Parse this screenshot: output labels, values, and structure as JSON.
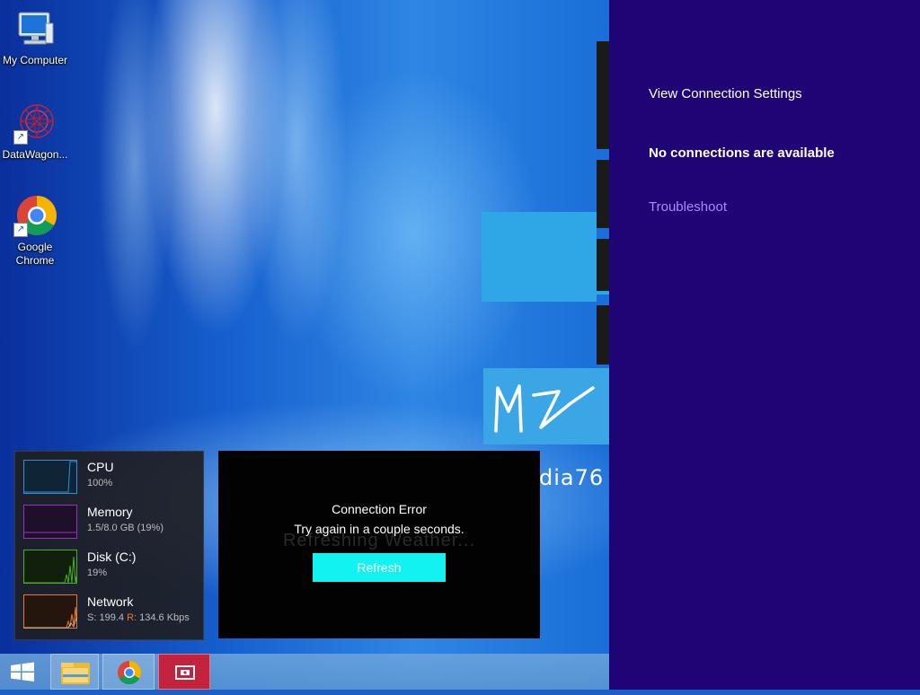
{
  "desktop": {
    "icons": [
      {
        "label": "My Computer",
        "icon": "computer-icon"
      },
      {
        "label": "DataWagon...",
        "icon": "datawagon-icon"
      },
      {
        "label": "Google Chrome",
        "icon": "chrome-icon"
      }
    ]
  },
  "background_app": {
    "partial_text": "dia76"
  },
  "resource_monitor": {
    "cpu": {
      "title": "CPU",
      "value": "100%",
      "color": "#2f8fd8"
    },
    "memory": {
      "title": "Memory",
      "value": "1.5/8.0 GB (19%)",
      "color": "#9b2fc4"
    },
    "disk": {
      "title": "Disk (C:)",
      "value": "19%",
      "color": "#4caf20"
    },
    "network": {
      "title": "Network",
      "sent_label": "S:",
      "sent_value": "199.4",
      "recv_label": "R:",
      "recv_value": "134.6 Kbps",
      "color": "#e07a30"
    }
  },
  "error_panel": {
    "title": "Connection Error",
    "message": "Try again in a couple seconds.",
    "ghost_text": "Refreshing Weather...",
    "refresh_label": "Refresh",
    "button_color": "#12f2f0"
  },
  "network_flyout": {
    "view_settings": "View Connection Settings",
    "status": "No connections are available",
    "troubleshoot": "Troubleshoot",
    "background_color": "#1e0474",
    "link_color": "#a98bff"
  },
  "taskbar": {
    "items": [
      "start-icon",
      "file-explorer-icon",
      "chrome-icon",
      "app-icon"
    ]
  }
}
